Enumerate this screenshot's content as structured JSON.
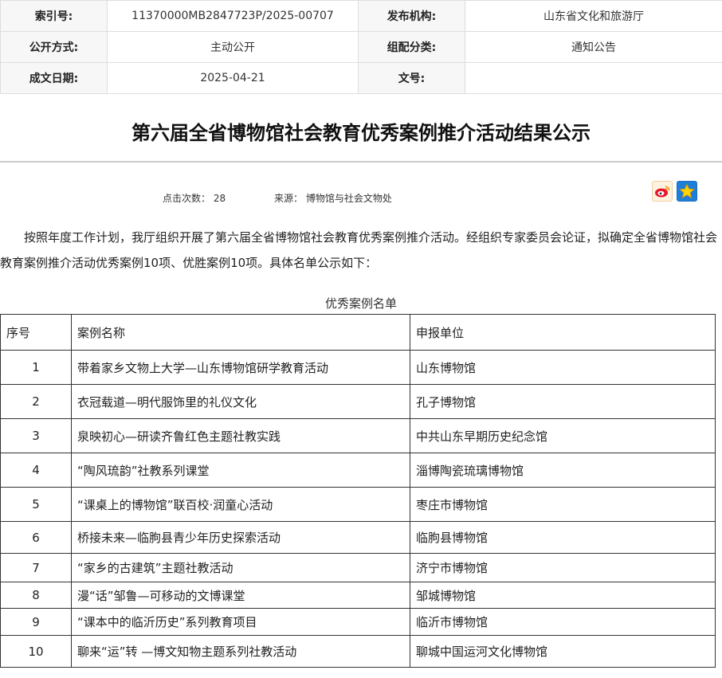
{
  "meta": {
    "rows": [
      {
        "k1": "索引号:",
        "v1": "11370000MB2847723P/2025-00707",
        "k2": "发布机构:",
        "v2": "山东省文化和旅游厅"
      },
      {
        "k1": "公开方式:",
        "v1": "主动公开",
        "k2": "组配分类:",
        "v2": "通知公告"
      },
      {
        "k1": "成文日期:",
        "v1": "2025-04-21",
        "k2": "文号:",
        "v2": ""
      }
    ]
  },
  "article": {
    "title": "第六届全省博物馆社会教育优秀案例推介活动结果公示",
    "clicks": "点击次数： 28",
    "source": "来源： 博物馆与社会文物处",
    "intro": "按照年度工作计划，我厅组织开展了第六届全省博物馆社会教育优秀案例推介活动。经组织专家委员会论证，拟确定全省博物馆社会教育案例推介活动优秀案例10项、优胜案例10项。具体名单公示如下："
  },
  "share": {
    "weibo_icon": "weibo-icon",
    "favorite_icon": "star-icon"
  },
  "cases_table": {
    "caption": "优秀案例名单",
    "headers": {
      "num": "序号",
      "name": "案例名称",
      "unit": "申报单位"
    },
    "rows": [
      {
        "num": "1",
        "name": "带着家乡文物上大学—山东博物馆研学教育活动",
        "unit": "山东博物馆"
      },
      {
        "num": "2",
        "name": "衣冠载道—明代服饰里的礼仪文化",
        "unit": "孔子博物馆"
      },
      {
        "num": "3",
        "name": "泉映初心—研读齐鲁红色主题社教实践",
        "unit": "中共山东早期历史纪念馆"
      },
      {
        "num": "4",
        "name": "“陶风琉韵”社教系列课堂",
        "unit": "淄博陶瓷琉璃博物馆"
      },
      {
        "num": "5",
        "name": "“课桌上的博物馆”联百校·润童心活动",
        "unit": "枣庄市博物馆"
      },
      {
        "num": "6",
        "name": "桥接未来—临朐县青少年历史探索活动",
        "unit": "临朐县博物馆"
      },
      {
        "num": "7",
        "name": "“家乡的古建筑”主题社教活动",
        "unit": "济宁市博物馆"
      },
      {
        "num": "8",
        "name": "漫“话”邹鲁—可移动的文博课堂",
        "unit": "邹城博物馆"
      },
      {
        "num": "9",
        "name": "“课本中的临沂历史”系列教育项目",
        "unit": "临沂市博物馆"
      },
      {
        "num": "10",
        "name": "聊来“运”转 —博文知物主题系列社教活动",
        "unit": "聊城中国运河文化博物馆"
      }
    ]
  }
}
